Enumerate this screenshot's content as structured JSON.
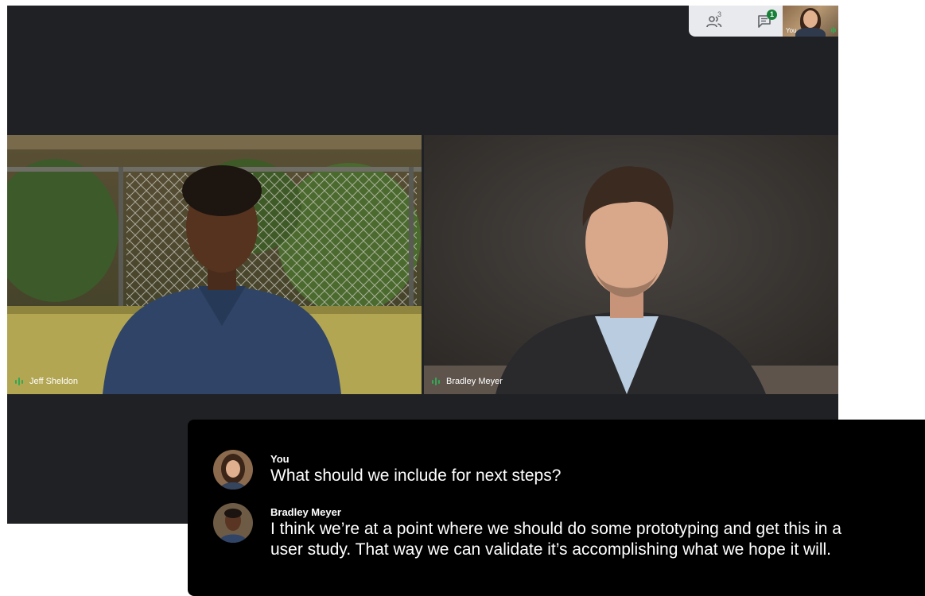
{
  "topbar": {
    "participants_icon": "people-icon",
    "participants_count": "3",
    "chat_icon": "chat-icon",
    "chat_badge": "1",
    "self_label": "You"
  },
  "tiles": [
    {
      "name": "Jeff Sheldon",
      "speaking_icon": "audio-level-icon"
    },
    {
      "name": "Bradley Meyer",
      "speaking_icon": "audio-level-icon"
    }
  ],
  "captions": [
    {
      "speaker": "You",
      "text": "What should we include for next steps?"
    },
    {
      "speaker": "Bradley Meyer",
      "text_line1": "I think we’re at a point where we should do some prototyping and get this in a",
      "text_line2": "user study. That way we can validate it’s accomplishing what we hope it will."
    }
  ],
  "colors": {
    "call_background": "#202124",
    "topbar_background": "#e9eaed",
    "badge_green": "#188038",
    "speaking_green": "#34a853",
    "caption_background": "#000000"
  }
}
